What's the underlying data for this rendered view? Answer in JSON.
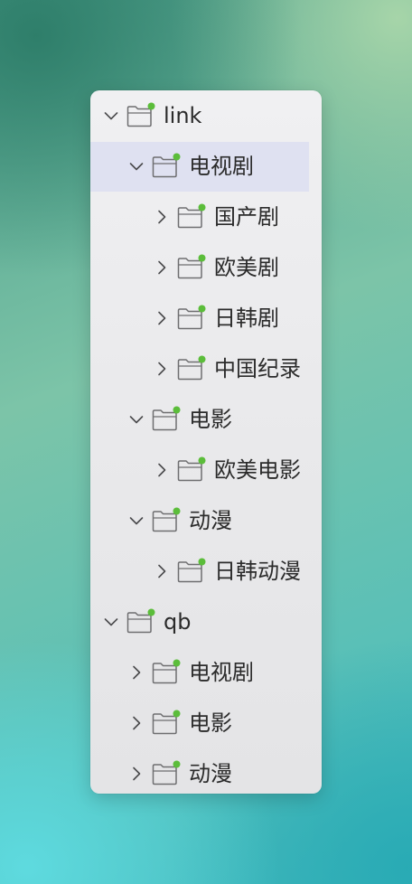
{
  "tree": {
    "items": [
      {
        "label": "link",
        "level": 0,
        "expanded": true,
        "selected": false,
        "icon": "folder-icon",
        "status_dot": "#5bbd3a"
      },
      {
        "label": "电视剧",
        "level": 1,
        "expanded": true,
        "selected": true,
        "icon": "folder-icon",
        "status_dot": "#5bbd3a"
      },
      {
        "label": "国产剧",
        "level": 2,
        "expanded": false,
        "selected": false,
        "icon": "folder-icon",
        "status_dot": "#5bbd3a"
      },
      {
        "label": "欧美剧",
        "level": 2,
        "expanded": false,
        "selected": false,
        "icon": "folder-icon",
        "status_dot": "#5bbd3a"
      },
      {
        "label": "日韩剧",
        "level": 2,
        "expanded": false,
        "selected": false,
        "icon": "folder-icon",
        "status_dot": "#5bbd3a"
      },
      {
        "label": "中国纪录",
        "level": 2,
        "expanded": false,
        "selected": false,
        "icon": "folder-icon",
        "status_dot": "#5bbd3a"
      },
      {
        "label": "电影",
        "level": 1,
        "expanded": true,
        "selected": false,
        "icon": "folder-icon",
        "status_dot": "#5bbd3a"
      },
      {
        "label": "欧美电影",
        "level": 2,
        "expanded": false,
        "selected": false,
        "icon": "folder-icon",
        "status_dot": "#5bbd3a"
      },
      {
        "label": "动漫",
        "level": 1,
        "expanded": true,
        "selected": false,
        "icon": "folder-icon",
        "status_dot": "#5bbd3a"
      },
      {
        "label": "日韩动漫",
        "level": 2,
        "expanded": false,
        "selected": false,
        "icon": "folder-icon",
        "status_dot": "#5bbd3a"
      },
      {
        "label": "qb",
        "level": 0,
        "expanded": true,
        "selected": false,
        "icon": "folder-icon",
        "status_dot": "#5bbd3a"
      },
      {
        "label": "电视剧",
        "level": 1,
        "expanded": false,
        "selected": false,
        "icon": "folder-icon",
        "status_dot": "#5bbd3a"
      },
      {
        "label": "电影",
        "level": 1,
        "expanded": false,
        "selected": false,
        "icon": "folder-icon",
        "status_dot": "#5bbd3a"
      },
      {
        "label": "动漫",
        "level": 1,
        "expanded": false,
        "selected": false,
        "icon": "folder-icon",
        "status_dot": "#5bbd3a"
      }
    ]
  },
  "colors": {
    "selection": "#dfe1f1",
    "text": "#2b2b2b",
    "icon_stroke": "#6e6e70",
    "status_dot": "#5bbd3a"
  }
}
